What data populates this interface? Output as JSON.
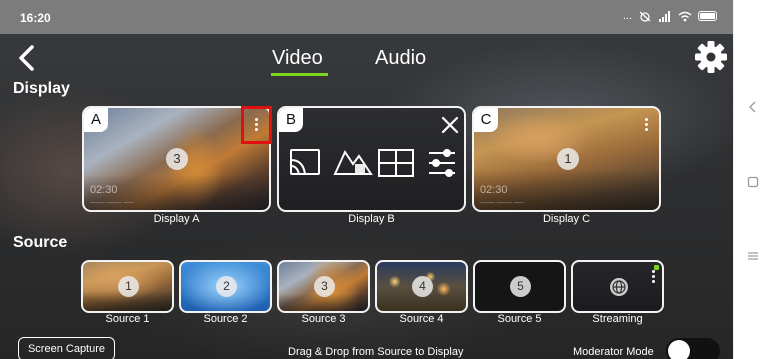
{
  "status_bar": {
    "time": "16:20",
    "dots": "..."
  },
  "header": {
    "tabs": [
      {
        "label": "Video",
        "active": true
      },
      {
        "label": "Audio",
        "active": false
      }
    ]
  },
  "display_section": {
    "title": "Display",
    "cards": [
      {
        "letter": "A",
        "badge": "3",
        "time": "02:30",
        "label": "Display A"
      },
      {
        "letter": "B",
        "label": "Display B"
      },
      {
        "letter": "C",
        "badge": "1",
        "time": "02:30",
        "label": "Display C"
      }
    ]
  },
  "source_section": {
    "title": "Source",
    "items": [
      {
        "badge": "1",
        "label": "Source 1"
      },
      {
        "badge": "2",
        "label": "Source 2"
      },
      {
        "badge": "3",
        "label": "Source 3"
      },
      {
        "badge": "4",
        "label": "Source 4"
      },
      {
        "badge": "5",
        "label": "Source 5"
      },
      {
        "label": "Streaming",
        "icon": "globe-icon"
      }
    ]
  },
  "footer": {
    "screen_capture_label": "Screen Capture",
    "hint": "Drag & Drop from Source to Display",
    "moderator_label": "Moderator Mode",
    "moderator_on": false
  },
  "colors": {
    "accent": "#7bd41e",
    "highlight": "#e01010",
    "status_bar": "#7c7c7c"
  }
}
